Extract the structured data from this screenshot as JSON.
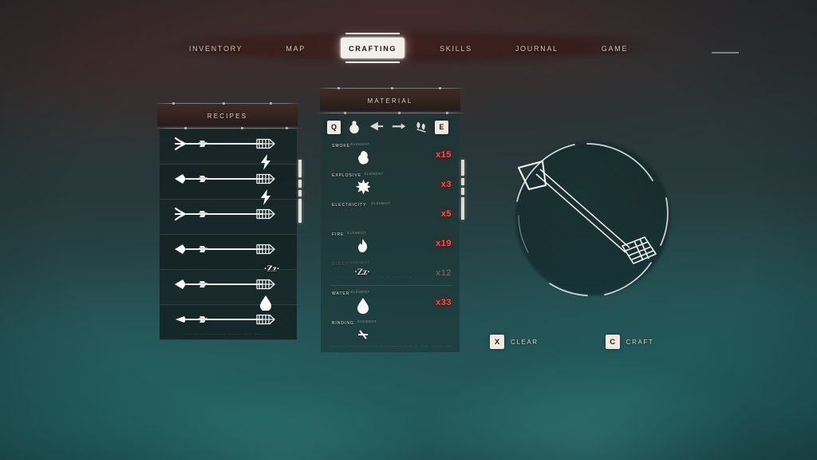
{
  "nav": {
    "items": [
      {
        "label": "Inventory",
        "active": false
      },
      {
        "label": "Map",
        "active": false
      },
      {
        "label": "Crafting",
        "active": true
      },
      {
        "label": "Skills",
        "active": false
      },
      {
        "label": "Journal",
        "active": false
      },
      {
        "label": "Game",
        "active": false
      }
    ]
  },
  "recipes": {
    "title": "Recipes",
    "footnote": "——  —  ——————  ———  —— ——  ——",
    "rows": [
      {
        "head": "trident",
        "effect": "lightning"
      },
      {
        "head": "broadhead",
        "effect": "lightning"
      },
      {
        "head": "trident",
        "effect": "none"
      },
      {
        "head": "broadhead",
        "effect": "sleep",
        "effect_text": "·Zz·"
      },
      {
        "head": "broadhead",
        "effect": "water"
      },
      {
        "head": "point",
        "effect": "none"
      }
    ]
  },
  "material": {
    "title": "Material",
    "key_prev": "Q",
    "key_next": "E",
    "tabs": [
      {
        "icon": "flask-icon",
        "selected": true
      },
      {
        "icon": "arrowhead-icon",
        "selected": false
      },
      {
        "icon": "shaft-icon",
        "selected": false
      },
      {
        "icon": "fletching-icon",
        "selected": false
      }
    ],
    "watermark": "········  ···  ··········",
    "footnote": "——  —  ———————  ————  ——— — ——  ——— —",
    "items": [
      {
        "name": "Smoke",
        "sub": "Element",
        "icon": "smoke-icon",
        "qty": "x15",
        "dim": false
      },
      {
        "name": "Explosive",
        "sub": "Element",
        "icon": "explosive-icon",
        "qty": "x3",
        "dim": false
      },
      {
        "name": "Electricity",
        "sub": "Element",
        "icon": "electricity-icon",
        "qty": "x5",
        "dim": false
      },
      {
        "name": "Fire",
        "sub": "Element",
        "icon": "fire-icon",
        "qty": "x19",
        "dim": false
      },
      {
        "name": "Sleep",
        "sub": "Element",
        "icon": "sleep-icon",
        "qty": "x12",
        "dim": true
      },
      {
        "name": "Water",
        "sub": "Element",
        "icon": "water-icon",
        "qty": "x33",
        "dim": false
      },
      {
        "name": "Binding",
        "sub": "Element",
        "icon": "binding-icon",
        "qty": "",
        "dim": false
      }
    ]
  },
  "preview": {
    "item": "arrow-preview"
  },
  "actions": {
    "clear_key": "X",
    "clear_label": "Clear",
    "craft_key": "C",
    "craft_label": "Craft"
  },
  "colors": {
    "accent_red": "#e8564e",
    "panel_banner": "#33231f",
    "panel_body": "#1f3435",
    "text_light": "#e2ddd6",
    "active_tab_bg": "#f2efe9"
  }
}
